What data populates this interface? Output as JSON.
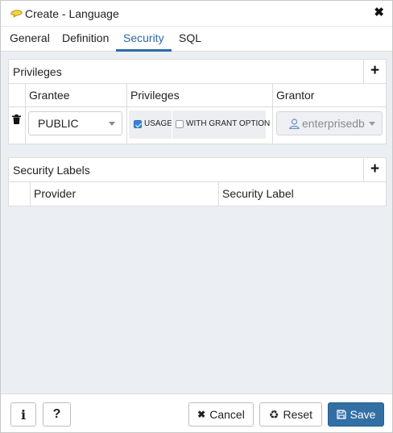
{
  "window": {
    "title": "Create - Language"
  },
  "tabs": [
    {
      "label": "General"
    },
    {
      "label": "Definition"
    },
    {
      "label": "Security",
      "active": true
    },
    {
      "label": "SQL"
    }
  ],
  "privileges": {
    "title": "Privileges",
    "headers": {
      "grantee": "Grantee",
      "privileges": "Privileges",
      "grantor": "Grantor"
    },
    "rows": [
      {
        "grantee": "PUBLIC",
        "usage_label": "USAGE",
        "usage_checked": true,
        "grant_option_label": "WITH GRANT OPTION",
        "grant_option_checked": false,
        "grantor": "enterprisedb"
      }
    ]
  },
  "security_labels": {
    "title": "Security Labels",
    "headers": {
      "provider": "Provider",
      "label": "Security Label"
    }
  },
  "footer": {
    "cancel": "Cancel",
    "reset": "Reset",
    "save": "Save"
  },
  "colors": {
    "accent": "#326fa5",
    "tab_active": "#2c6aa8",
    "checkbox": "#3b82d6"
  }
}
